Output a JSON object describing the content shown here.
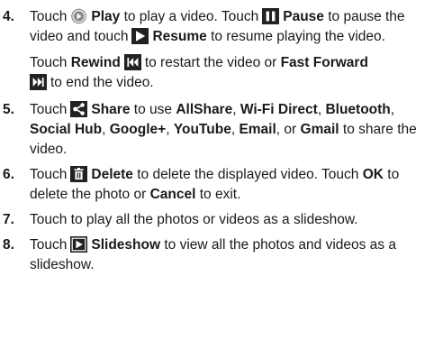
{
  "items": [
    {
      "num": "4.",
      "t1": "Touch",
      "play": "Play",
      "t2": "to play a video. Touch",
      "pause": "Pause",
      "t3": "to pause the video and touch",
      "resume": "Resume",
      "t4": "to resume playing the video.",
      "s1": "Touch",
      "rewind": "Rewind",
      "s2": "to restart the video or",
      "ff": "Fast Forward",
      "s3": "to end the video."
    },
    {
      "num": "5.",
      "t1": "Touch",
      "share": "Share",
      "t2": "to use",
      "allshare": "AllShare",
      "wifi": "Wi-Fi Direct",
      "bluetooth": "Bluetooth",
      "socialhub": "Social Hub",
      "googleplus": "Google+",
      "youtube": "YouTube",
      "email": "Email",
      "or": "or",
      "gmail": "Gmail",
      "t3": "to share the video."
    },
    {
      "num": "6.",
      "t1": "Touch",
      "delete": "Delete",
      "t2": "to delete the displayed video. Touch",
      "ok": "OK",
      "t3": "to delete the photo or",
      "cancel": "Cancel",
      "t4": "to exit."
    },
    {
      "num": "7.",
      "text": "Touch to play all the photos or videos as a slideshow."
    },
    {
      "num": "8.",
      "t1": "Touch",
      "slideshow": "Slideshow",
      "t2": "to view all the photos and videos as a slideshow."
    }
  ],
  "icons": [
    "play-icon",
    "pause-icon",
    "resume-icon",
    "rewind-icon",
    "fast-forward-icon",
    "share-icon",
    "delete-icon",
    "slideshow-icon"
  ],
  "colors": {
    "text": "#1a1a1a",
    "icon_dark": "#222222",
    "icon_gray": "#8a8a8a"
  }
}
